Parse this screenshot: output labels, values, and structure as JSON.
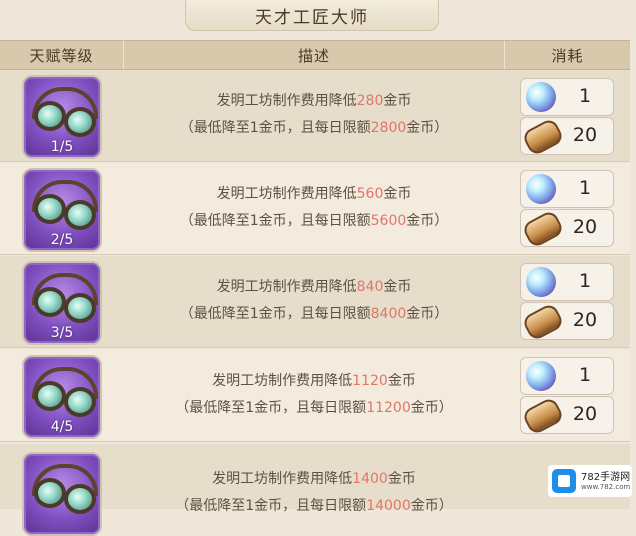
{
  "title": "天才工匠大师",
  "headers": {
    "level": "天赋等级",
    "desc": "描述",
    "cost": "消耗"
  },
  "rows": [
    {
      "level": "1/5",
      "desc_pre": "发明工坊制作费用降低",
      "reduce": "280",
      "desc_post": "金币",
      "sub_pre": "（最低降至1金币，且每日限额",
      "limit": "2800",
      "sub_post": "金币）",
      "costs": [
        {
          "icon": "crystal-orb-icon",
          "amount": "1"
        },
        {
          "icon": "scroll-icon",
          "amount": "20"
        }
      ]
    },
    {
      "level": "2/5",
      "desc_pre": "发明工坊制作费用降低",
      "reduce": "560",
      "desc_post": "金币",
      "sub_pre": "（最低降至1金币，且每日限额",
      "limit": "5600",
      "sub_post": "金币）",
      "costs": [
        {
          "icon": "crystal-orb-icon",
          "amount": "1"
        },
        {
          "icon": "scroll-icon",
          "amount": "20"
        }
      ]
    },
    {
      "level": "3/5",
      "desc_pre": "发明工坊制作费用降低",
      "reduce": "840",
      "desc_post": "金币",
      "sub_pre": "（最低降至1金币，且每日限额",
      "limit": "8400",
      "sub_post": "金币）",
      "costs": [
        {
          "icon": "crystal-orb-icon",
          "amount": "1"
        },
        {
          "icon": "scroll-icon",
          "amount": "20"
        }
      ]
    },
    {
      "level": "4/5",
      "desc_pre": "发明工坊制作费用降低",
      "reduce": "1120",
      "desc_post": "金币",
      "sub_pre": "（最低降至1金币，且每日限额",
      "limit": "11200",
      "sub_post": "金币）",
      "costs": [
        {
          "icon": "crystal-orb-icon",
          "amount": "1"
        },
        {
          "icon": "scroll-icon",
          "amount": "20"
        }
      ]
    },
    {
      "level": "",
      "desc_pre": "发明工坊制作费用降低",
      "reduce": "1400",
      "desc_post": "金币",
      "sub_pre": "（最低降至1金币，且每日限额",
      "limit": "14000",
      "sub_post": "金币）",
      "costs": []
    }
  ],
  "colors": {
    "highlight": "#e2766b",
    "text": "#5d5045",
    "background": "#efe8da"
  },
  "watermark": {
    "name": "782手游网",
    "sub": "www.782.com"
  }
}
